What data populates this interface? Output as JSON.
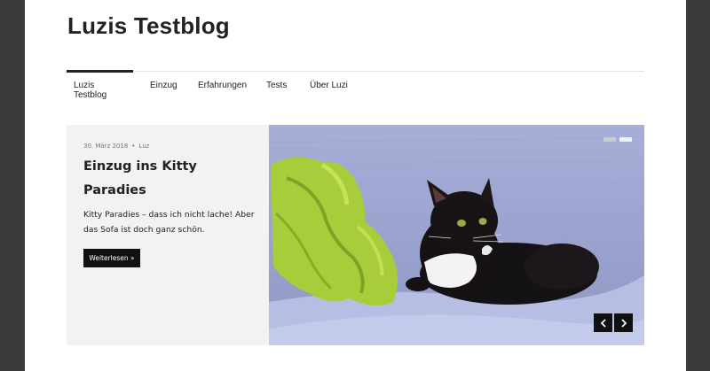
{
  "site": {
    "title": "Luzis Testblog"
  },
  "nav": {
    "items": [
      {
        "label": "Luzis Testblog"
      },
      {
        "label": "Einzug"
      },
      {
        "label": "Erfahrungen"
      },
      {
        "label": "Tests"
      },
      {
        "label": "Über Luzi"
      }
    ]
  },
  "slider": {
    "slide": {
      "date": "30. März 2018",
      "author": "Luz",
      "separator": "•",
      "title": "Einzug ins Kitty Paradies",
      "excerpt": "Kitty Paradies – dass ich nicht lache! Aber das Sofa ist doch ganz schön.",
      "read_more": "Weiterlesen »"
    },
    "indicators": 2,
    "active_indicator": 2
  },
  "colors": {
    "outer_background": "#3a3a3a",
    "text": "#222222",
    "slide_panel": "#f2f2f2",
    "button": "#111111"
  }
}
